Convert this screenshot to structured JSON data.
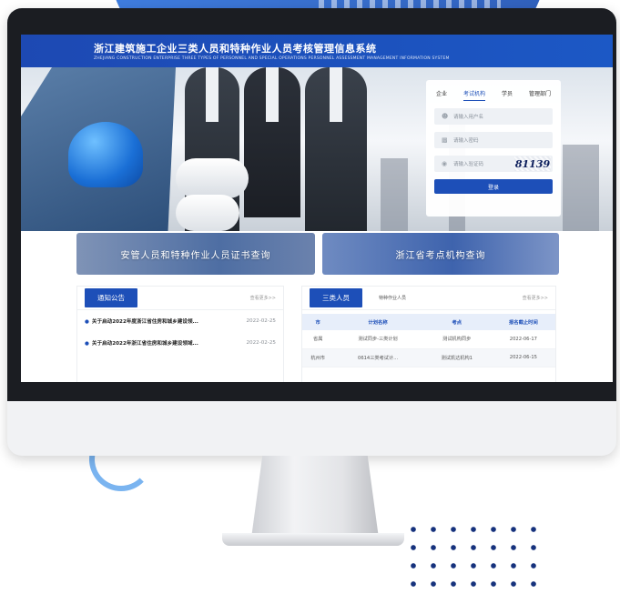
{
  "site": {
    "title": "浙江建筑施工企业三类人员和特种作业人员考核管理信息系统",
    "subtitle": "ZHEJIANG CONSTRUCTION ENTERPRISE THREE TYPES OF PERSONNEL AND SPECIAL OPERATIONS PERSONNEL ASSESSMENT MANAGEMENT INFORMATION SYSTEM"
  },
  "login": {
    "tabs": [
      {
        "label": "企业",
        "active": false
      },
      {
        "label": "考试机构",
        "active": true
      },
      {
        "label": "学员",
        "active": false
      },
      {
        "label": "管理部门",
        "active": false
      }
    ],
    "username_placeholder": "请输入用户名",
    "password_placeholder": "请输入密码",
    "captcha_placeholder": "请输入验证码",
    "captcha_code": "81139",
    "submit_label": "登录"
  },
  "banners": {
    "certificate_query": "安管人员和特种作业人员证书查询",
    "exam_center_query": "浙江省考点机构查询"
  },
  "notice": {
    "title": "通知公告",
    "more": "查看更多>>",
    "items": [
      {
        "title": "关于启动2022年度浙江省住房和城乡建设领...",
        "date": "2022-02-25"
      },
      {
        "title": "关于启动2022年浙江省住房和城乡建设领域...",
        "date": "2022-02-25"
      }
    ]
  },
  "persons": {
    "title": "三类人员",
    "tab2": "特种作业人员",
    "more": "查看更多>>",
    "columns": [
      "市",
      "计划名称",
      "考点",
      "报名截止时间"
    ],
    "rows": [
      [
        "省属",
        "测试同步-三类计划",
        "测试机构同步",
        "2022-06-17"
      ],
      [
        "杭州市",
        "0614三类考试计...",
        "测试凯达机构1",
        "2022-06-15"
      ]
    ]
  }
}
